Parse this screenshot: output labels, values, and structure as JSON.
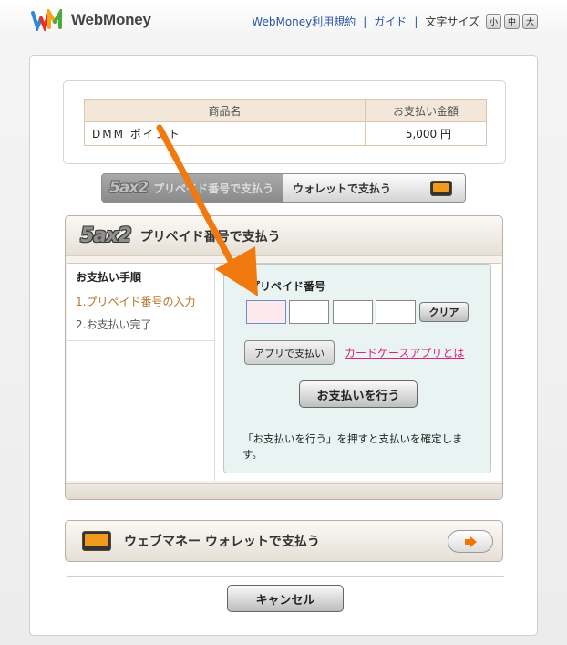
{
  "header": {
    "logo_text": "WebMoney",
    "nav": {
      "terms": "WebMoney利用規約",
      "separator": "|",
      "guide": "ガイド",
      "font_size_label": "文字サイズ",
      "font_small": "小",
      "font_medium": "中",
      "font_large": "大"
    }
  },
  "order": {
    "col_product": "商品名",
    "col_amount": "お支払い金額",
    "product": "DMM ポイント",
    "amount": "5,000 円"
  },
  "tabs": {
    "active_logo": "5ax2",
    "active_label": "プリペイド番号で支払う",
    "inactive_label": "ウォレットで支払う",
    "wallet_icon": "wallet-icon"
  },
  "prepaid": {
    "logo": "5ax2",
    "title": "プリペイド番号で支払う",
    "steps_title": "お支払い手順",
    "step1": "1.プリペイド番号の入力",
    "step2": "2.お支払い完了",
    "pin_label": "プリペイド番号",
    "pin_values": [
      "",
      "",
      "",
      ""
    ],
    "clear_button": "クリア",
    "app_button": "アプリで支払い",
    "app_link": "カードケースアプリとは",
    "pay_button": "お支払いを行う",
    "note": "「お支払いを行う」を押すと支払いを確定します。"
  },
  "wallet": {
    "title": "ウェブマネー ウォレットで支払う",
    "arrow_icon": "arrow-right-icon"
  },
  "cancel_button": "キャンセル",
  "colors": {
    "link_blue": "#2a55a4",
    "step_active": "#b8742a",
    "app_link": "#e0207a",
    "annotation_arrow": "#f07a10",
    "form_bg": "#e9f4f2"
  }
}
